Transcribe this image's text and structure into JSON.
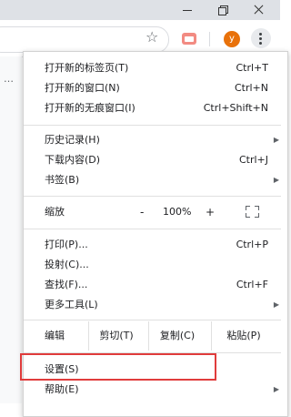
{
  "toolbar": {
    "avatar_letter": "y"
  },
  "menu": {
    "group1": [
      {
        "label": "打开新的标签页(T)",
        "shortcut": "Ctrl+T"
      },
      {
        "label": "打开新的窗口(N)",
        "shortcut": "Ctrl+N"
      },
      {
        "label": "打开新的无痕窗口(I)",
        "shortcut": "Ctrl+Shift+N"
      }
    ],
    "group2": [
      {
        "label": "历史记录(H)",
        "shortcut": ""
      },
      {
        "label": "下载内容(D)",
        "shortcut": "Ctrl+J"
      },
      {
        "label": "书签(B)",
        "shortcut": ""
      }
    ],
    "zoom": {
      "label": "缩放",
      "minus": "-",
      "value": "100%",
      "plus": "+"
    },
    "group3": [
      {
        "label": "打印(P)...",
        "shortcut": "Ctrl+P"
      },
      {
        "label": "投射(C)...",
        "shortcut": ""
      },
      {
        "label": "查找(F)...",
        "shortcut": "Ctrl+F"
      },
      {
        "label": "更多工具(L)",
        "shortcut": ""
      }
    ],
    "edit": {
      "label": "编辑",
      "cut": "剪切(T)",
      "copy": "复制(C)",
      "paste": "粘贴(P)"
    },
    "group4": [
      {
        "label": "设置(S)"
      },
      {
        "label": "帮助(E)"
      }
    ]
  },
  "colors": {
    "highlight": "#e03c3c",
    "avatar": "#e8710a"
  },
  "icons": [
    "minimize-icon",
    "maximize-icon",
    "close-icon",
    "star-icon",
    "extension-icon",
    "menu-dots-icon",
    "fullscreen-icon",
    "submenu-arrow-icon"
  ]
}
